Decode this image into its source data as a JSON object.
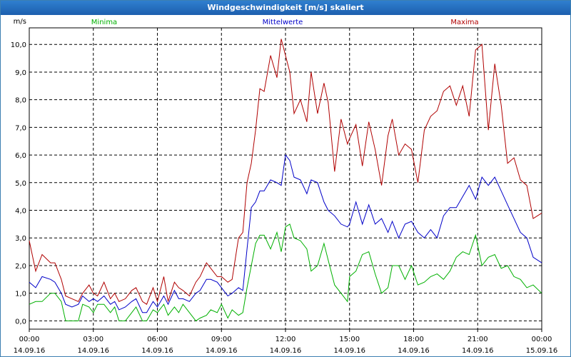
{
  "window": {
    "title": "Windgeschwindigkeit [m/s] skaliert"
  },
  "chart_data": {
    "type": "line",
    "title": "Windgeschwindigkeit [m/s] skaliert",
    "ylabel": "m/s",
    "ylim": [
      -0.3,
      10.6
    ],
    "y_ticks": [
      "0,0",
      "1,0",
      "2,0",
      "3,0",
      "4,0",
      "5,0",
      "6,0",
      "7,0",
      "8,0",
      "9,0",
      "10,0"
    ],
    "xlim": [
      0,
      24
    ],
    "x_ticks": [
      {
        "hour": 0,
        "time": "00:00",
        "date": "14.09.16"
      },
      {
        "hour": 3,
        "time": "03:00",
        "date": "14.09.16"
      },
      {
        "hour": 6,
        "time": "06:00",
        "date": "14.09.16"
      },
      {
        "hour": 9,
        "time": "09:00",
        "date": "14.09.16"
      },
      {
        "hour": 12,
        "time": "12:00",
        "date": "14.09.16"
      },
      {
        "hour": 15,
        "time": "15:00",
        "date": "14.09.16"
      },
      {
        "hour": 18,
        "time": "18:00",
        "date": "14.09.16"
      },
      {
        "hour": 21,
        "time": "21:00",
        "date": "14.09.16"
      },
      {
        "hour": 24,
        "time": "00:00",
        "date": "15.09.16"
      }
    ],
    "grid": true,
    "series": [
      {
        "name": "Minima",
        "color": "#00b000",
        "legend_position": "left",
        "x": [
          0,
          0.3,
          0.6,
          1,
          1.2,
          1.5,
          1.7,
          2,
          2.3,
          2.5,
          2.8,
          3,
          3.2,
          3.5,
          3.8,
          4,
          4.2,
          4.5,
          4.8,
          5,
          5.3,
          5.5,
          5.8,
          6,
          6.3,
          6.5,
          6.8,
          7,
          7.2,
          7.5,
          7.8,
          8,
          8.3,
          8.5,
          8.8,
          9,
          9.3,
          9.5,
          9.8,
          10,
          10.2,
          10.4,
          10.6,
          10.8,
          11,
          11.3,
          11.6,
          11.8,
          12,
          12.2,
          12.4,
          12.7,
          13,
          13.2,
          13.5,
          13.8,
          14,
          14.3,
          14.6,
          14.9,
          15,
          15.3,
          15.6,
          15.9,
          16.2,
          16.5,
          16.8,
          17,
          17.3,
          17.6,
          17.9,
          18.2,
          18.5,
          18.8,
          19.1,
          19.4,
          19.7,
          20,
          20.3,
          20.6,
          20.9,
          21.2,
          21.5,
          21.8,
          22.1,
          22.4,
          22.7,
          23,
          23.3,
          23.6,
          24
        ],
        "values": [
          0.6,
          0.7,
          0.7,
          1.0,
          1.0,
          0.7,
          0,
          0,
          0,
          0.6,
          0.5,
          0.3,
          0.6,
          0.6,
          0.3,
          0.5,
          0,
          0,
          0.3,
          0.5,
          0,
          0,
          0.4,
          0.3,
          0.6,
          0.2,
          0.5,
          0.3,
          0.6,
          0.3,
          0,
          0.1,
          0.2,
          0.4,
          0.3,
          0.6,
          0.1,
          0.4,
          0.2,
          0.3,
          1.2,
          2.0,
          2.8,
          3.1,
          3.1,
          2.6,
          3.2,
          2.5,
          3.4,
          3.5,
          3.0,
          2.9,
          2.6,
          1.8,
          2.0,
          2.8,
          2.2,
          1.3,
          1.0,
          0.7,
          1.6,
          1.8,
          2.4,
          2.5,
          1.7,
          1.0,
          1.2,
          2.0,
          2.0,
          1.5,
          2.0,
          1.3,
          1.4,
          1.6,
          1.7,
          1.5,
          1.8,
          2.3,
          2.5,
          2.4,
          3.1,
          2.0,
          2.3,
          2.4,
          1.9,
          2.0,
          1.6,
          1.5,
          1.2,
          1.3,
          1.0
        ]
      },
      {
        "name": "Mittelwerte",
        "color": "#0000c8",
        "legend_position": "center",
        "x": [
          0,
          0.3,
          0.6,
          1,
          1.2,
          1.5,
          1.7,
          2,
          2.3,
          2.5,
          2.8,
          3,
          3.2,
          3.5,
          3.8,
          4,
          4.2,
          4.5,
          4.8,
          5,
          5.3,
          5.5,
          5.8,
          6,
          6.3,
          6.5,
          6.8,
          7,
          7.2,
          7.5,
          7.8,
          8,
          8.3,
          8.5,
          8.8,
          9,
          9.3,
          9.5,
          9.8,
          10,
          10.2,
          10.4,
          10.6,
          10.8,
          11,
          11.3,
          11.6,
          11.8,
          12,
          12.2,
          12.4,
          12.7,
          13,
          13.2,
          13.5,
          13.8,
          14,
          14.3,
          14.6,
          14.9,
          15,
          15.3,
          15.6,
          15.9,
          16.2,
          16.5,
          16.8,
          17,
          17.3,
          17.6,
          17.9,
          18.2,
          18.5,
          18.8,
          19.1,
          19.4,
          19.7,
          20,
          20.3,
          20.6,
          20.9,
          21.2,
          21.5,
          21.8,
          22.1,
          22.4,
          22.7,
          23,
          23.3,
          23.6,
          24
        ],
        "values": [
          1.4,
          1.2,
          1.6,
          1.5,
          1.4,
          1.0,
          0.6,
          0.5,
          0.6,
          0.9,
          0.7,
          0.8,
          0.7,
          0.9,
          0.6,
          0.7,
          0.4,
          0.5,
          0.7,
          0.8,
          0.3,
          0.3,
          0.7,
          0.5,
          0.9,
          0.6,
          1.1,
          0.8,
          0.8,
          0.7,
          1.0,
          1.1,
          1.5,
          1.5,
          1.4,
          1.2,
          0.9,
          1.0,
          1.2,
          1.1,
          2.6,
          4.1,
          4.3,
          4.7,
          4.7,
          5.1,
          5.0,
          4.9,
          6.0,
          5.8,
          5.2,
          5.1,
          4.6,
          5.1,
          5.0,
          4.3,
          4.0,
          3.8,
          3.5,
          3.4,
          3.5,
          4.3,
          3.5,
          4.2,
          3.5,
          3.7,
          3.2,
          3.6,
          3.0,
          3.5,
          3.6,
          3.2,
          3.0,
          3.3,
          3.0,
          3.8,
          4.1,
          4.1,
          4.5,
          4.9,
          4.4,
          5.2,
          4.9,
          5.2,
          4.7,
          4.2,
          3.7,
          3.2,
          3.0,
          2.3,
          2.1
        ]
      },
      {
        "name": "Maxima",
        "color": "#b00000",
        "legend_position": "right",
        "x": [
          0,
          0.3,
          0.6,
          1,
          1.2,
          1.5,
          1.7,
          2,
          2.3,
          2.5,
          2.8,
          3,
          3.2,
          3.5,
          3.8,
          4,
          4.2,
          4.5,
          4.8,
          5,
          5.3,
          5.5,
          5.8,
          6,
          6.3,
          6.5,
          6.8,
          7,
          7.2,
          7.5,
          7.8,
          8,
          8.3,
          8.5,
          8.8,
          9,
          9.3,
          9.5,
          9.8,
          10,
          10.2,
          10.4,
          10.6,
          10.8,
          11,
          11.3,
          11.6,
          11.8,
          12,
          12.2,
          12.4,
          12.7,
          13,
          13.2,
          13.5,
          13.8,
          14,
          14.3,
          14.6,
          14.9,
          15,
          15.3,
          15.6,
          15.9,
          16.2,
          16.5,
          16.8,
          17,
          17.3,
          17.6,
          17.9,
          18.2,
          18.5,
          18.8,
          19.1,
          19.4,
          19.7,
          20,
          20.3,
          20.6,
          20.9,
          21.2,
          21.5,
          21.8,
          22.1,
          22.4,
          22.7,
          23,
          23.3,
          23.6,
          24
        ],
        "values": [
          2.9,
          1.8,
          2.4,
          2.1,
          2.1,
          1.5,
          0.9,
          0.8,
          0.7,
          1.0,
          1.3,
          1.0,
          0.9,
          1.4,
          0.8,
          1.0,
          0.7,
          0.8,
          1.1,
          1.2,
          0.7,
          0.6,
          1.2,
          0.7,
          1.6,
          0.7,
          1.4,
          1.2,
          1.1,
          0.9,
          1.4,
          1.6,
          2.1,
          1.9,
          1.6,
          1.6,
          1.4,
          1.5,
          3.0,
          3.2,
          5.0,
          5.7,
          6.9,
          8.4,
          8.3,
          9.6,
          8.8,
          10.2,
          9.6,
          9.0,
          7.5,
          8.0,
          7.2,
          9.0,
          7.5,
          8.6,
          7.9,
          5.4,
          7.3,
          6.4,
          6.6,
          7.1,
          5.6,
          7.2,
          6.2,
          4.9,
          6.7,
          7.3,
          6.0,
          6.4,
          6.2,
          5.0,
          6.9,
          7.4,
          7.6,
          8.3,
          8.5,
          7.8,
          8.5,
          7.4,
          9.8,
          10.0,
          6.9,
          9.3,
          7.8,
          5.7,
          5.9,
          5.1,
          4.9,
          3.7,
          3.9
        ]
      }
    ]
  }
}
